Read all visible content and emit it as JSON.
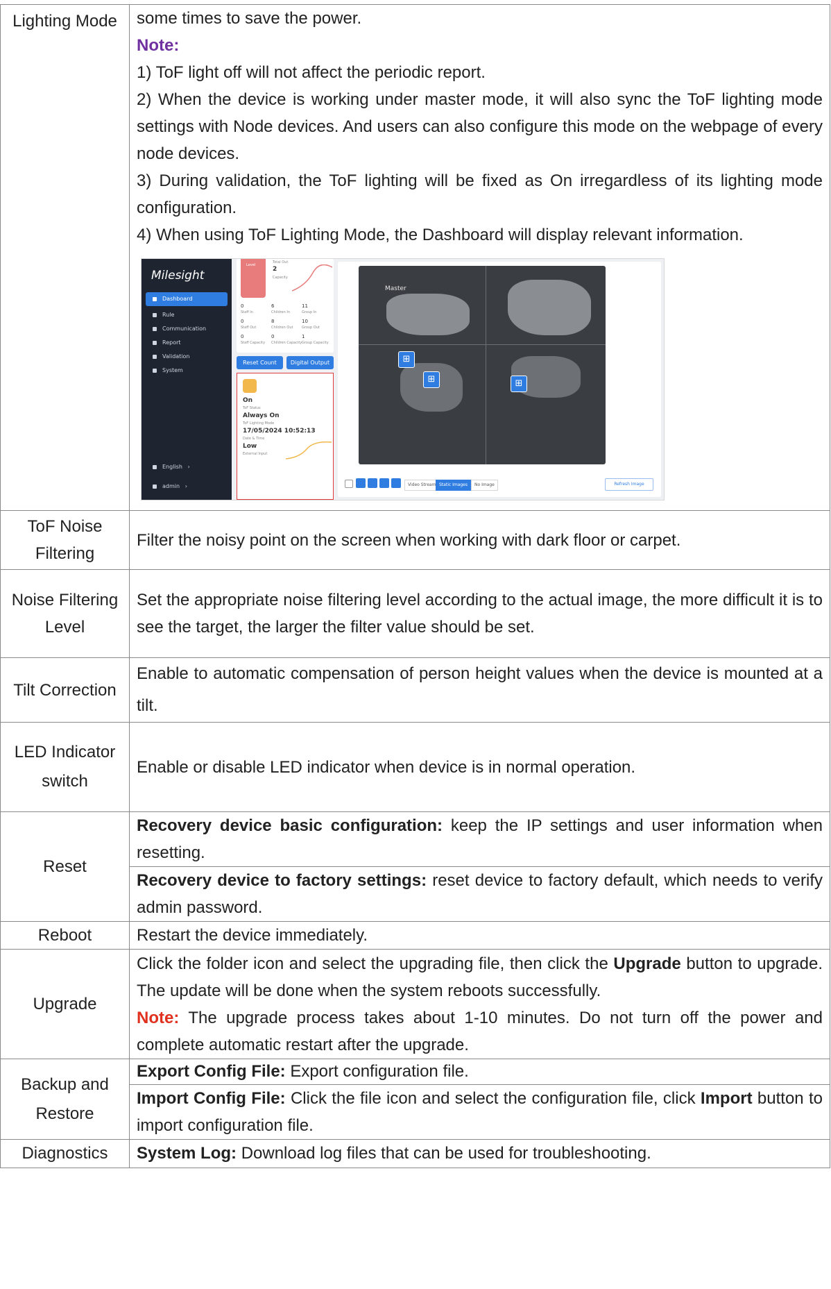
{
  "rows": {
    "lighting": {
      "label": "Lighting Mode",
      "line1": "some times to save the power.",
      "note_label": "Note:",
      "notes": [
        "1) ToF light off will not affect the periodic report.",
        "2) When the device is working under master mode, it will also sync the ToF lighting mode settings with Node devices. And users can also configure this mode on the webpage of every node devices.",
        "3) During validation, the ToF lighting will be fixed as On irregardless of its lighting mode configuration.",
        "4) When using ToF Lighting Mode, the Dashboard will display relevant information."
      ]
    },
    "tof_noise": {
      "label": "ToF Noise Filtering",
      "desc": "Filter the noisy point on the screen when working with dark floor or carpet."
    },
    "noise_level": {
      "label": "Noise Filtering Level",
      "desc": "Set the appropriate noise filtering level according to the actual image, the more difficult it is to see the target, the larger the filter value should be set."
    },
    "tilt": {
      "label": "Tilt Correction",
      "desc": "Enable to automatic compensation of person height values when the device is mounted at a tilt."
    },
    "led": {
      "label": "LED Indicator switch",
      "desc": "Enable or disable LED indicator when device is in normal operation."
    },
    "reset": {
      "label": "Reset",
      "basic_bold": "Recovery device basic configuration:",
      "basic_text": " keep the IP settings and user information when resetting.",
      "factory_bold": "Recovery device to factory settings:",
      "factory_text": " reset device to factory default, which needs to verify admin password."
    },
    "reboot": {
      "label": "Reboot",
      "desc": "Restart the device immediately."
    },
    "upgrade": {
      "label": "Upgrade",
      "text1": "Click the folder icon and select the upgrading file, then click the ",
      "bold1": "Upgrade",
      "text2": " button to upgrade. The update will be done when the system reboots successfully.",
      "note_label": "Note:",
      "note_text": " The upgrade process takes about 1-10 minutes. Do not turn off the power and complete automatic restart after the upgrade."
    },
    "backup": {
      "label": "Backup and Restore",
      "export_bold": "Export Config File:",
      "export_text": " Export configuration file.",
      "import_bold": "Import Config File:",
      "import_text": " Click the file icon and select the configuration file, click ",
      "import_bold2": "Import",
      "import_text2": " button to import configuration file."
    },
    "diagnostics": {
      "label": "Diagnostics",
      "log_bold": "System Log:",
      "log_text": " Download log files that can be used for troubleshooting."
    }
  },
  "screenshot": {
    "logo": "Milesight",
    "menu": [
      "Dashboard",
      "Rule",
      "Communication",
      "Report",
      "Validation",
      "System"
    ],
    "language": "English",
    "user": "admin",
    "total_out_label": "Total Out",
    "total_out_value": "2",
    "capacity_label": "Capacity",
    "level_label": "Level",
    "stats": [
      {
        "v": "0",
        "l": "Staff In"
      },
      {
        "v": "6",
        "l": "Children In"
      },
      {
        "v": "11",
        "l": "Group In"
      },
      {
        "v": "0",
        "l": "Staff Out"
      },
      {
        "v": "8",
        "l": "Children Out"
      },
      {
        "v": "10",
        "l": "Group Out"
      },
      {
        "v": "0",
        "l": "Staff Capacity"
      },
      {
        "v": "0",
        "l": "Children Capacity"
      },
      {
        "v": "1",
        "l": "Group Capacity"
      }
    ],
    "reset_count": "Reset Count",
    "digital_output": "Digital Output",
    "tof_status_value": "On",
    "tof_status_label": "ToF Status",
    "tof_mode_value": "Always On",
    "tof_mode_label": "ToF Lighting Mode",
    "datetime_value": "17/05/2024 10:52:13",
    "datetime_label": "Date & Time",
    "ext_value": "Low",
    "ext_label": "External Input",
    "master_label": "Master",
    "tabs": [
      "Video Stream",
      "Static Images",
      "No Image"
    ],
    "refresh": "Refresh Image"
  }
}
